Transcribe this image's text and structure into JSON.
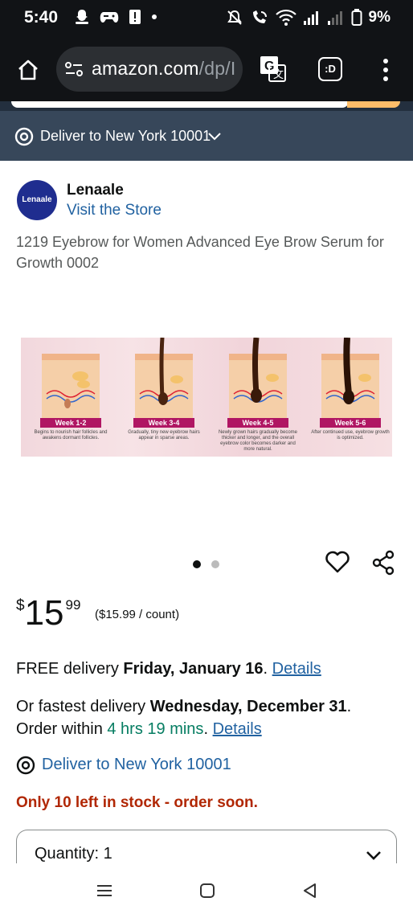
{
  "status_bar": {
    "time": "5:40",
    "battery": "9%"
  },
  "browser": {
    "url_host": "amazon.com",
    "url_path": "/dp/I",
    "tab_label": ":D"
  },
  "deliver_bar": {
    "text": "Deliver to New York 10001"
  },
  "brand": {
    "logo_text": "Lenaale",
    "name": "Lenaale",
    "store_link": "Visit the Store"
  },
  "product": {
    "title": "1219 Eyebrow for Women Advanced Eye Brow Serum for Growth 0002",
    "image_stages": [
      {
        "label": "Week 1-2",
        "desc": "Begins to nourish hair follicles and awakens dormant follicles."
      },
      {
        "label": "Week 3-4",
        "desc": "Gradually, tiny new eyebrow hairs appear in sparse areas."
      },
      {
        "label": "Week 4-5",
        "desc": "Newly grown hairs gradually become thicker and longer, and the overall eyebrow color becomes darker and more natural."
      },
      {
        "label": "Week 5-6",
        "desc": "After continued use, eyebrow growth is optimized."
      }
    ]
  },
  "price": {
    "symbol": "$",
    "whole": "15",
    "fraction": "99",
    "per_unit": "($15.99 / count)"
  },
  "delivery": {
    "free_prefix": "FREE delivery ",
    "free_date": "Friday, January 16",
    "free_suffix": ". ",
    "details_link": "Details",
    "fastest_prefix": "Or fastest delivery ",
    "fastest_date": "Wednesday, December 31",
    "fastest_suffix": ".",
    "order_within_prefix": "Order within ",
    "order_within_time": "4 hrs 19 mins",
    "order_within_suffix": ". ",
    "deliver_to": "Deliver to New York 10001"
  },
  "stock": {
    "text": "Only 10 left in stock - order soon."
  },
  "quantity": {
    "label": "Quantity: 1"
  }
}
